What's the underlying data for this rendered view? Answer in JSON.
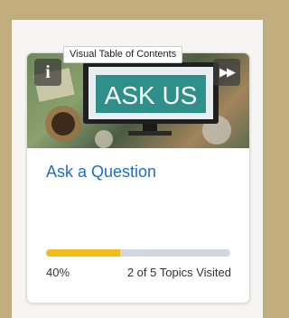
{
  "tooltip": "Visual Table of Contents",
  "card": {
    "image_text": "ASK US",
    "info_icon": "i",
    "next_icon": "▶▶",
    "title": "Ask a Question",
    "progress": {
      "fraction": 0.4,
      "percent_label": "40%",
      "topics_label": "2 of 5 Topics Visited"
    }
  },
  "colors": {
    "accent": "#1f6fc2",
    "progress_fill": "#f2bd1b",
    "progress_track": "#d2d7dd",
    "frame": "#c2ad7d"
  }
}
